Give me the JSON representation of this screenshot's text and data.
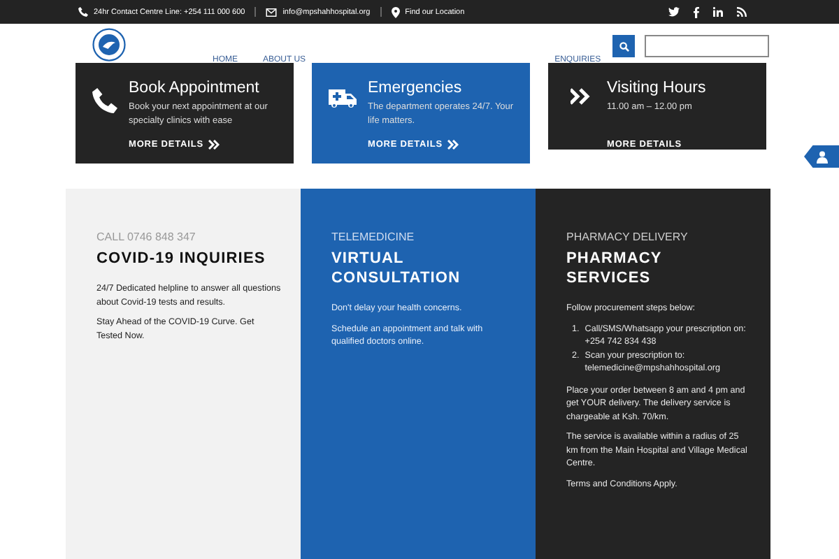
{
  "top_bar": {
    "contacts": [
      {
        "kind": "phone",
        "text": "24hr Contact Centre Line: +254 111 000 600"
      },
      {
        "kind": "mail",
        "text": "info@mpshahhospital.org"
      },
      {
        "kind": "pin",
        "text": "Find our Location"
      }
    ]
  },
  "nav": {
    "items": [
      "HOME",
      "ABOUT US",
      "ENQUIRIES"
    ]
  },
  "cards": [
    {
      "kind": "phone",
      "title": "Book Appointment",
      "text": "Book your next appointment at our specialty clinics with ease",
      "link": "MORE DETAILS",
      "arrow": true
    },
    {
      "kind": "ambulance",
      "title": "Emergencies",
      "text": "The department operates 24/7. Your life matters.",
      "link": "MORE DETAILS",
      "arrow": true
    },
    {
      "kind": "chevrons",
      "title": "Visiting Hours",
      "text": "11.00 am – 12.00 pm",
      "link": "MORE DETAILS",
      "arrow": false
    }
  ],
  "sections": [
    {
      "eyebrow": "CALL 0746 848 347",
      "title": "COVID-19 INQUIRIES",
      "blocks": [
        {
          "kind": "p",
          "text": "24/7 Dedicated helpline to answer all questions about Covid-19 tests and results."
        },
        {
          "kind": "p",
          "text": "Stay Ahead of the COVID-19 Curve.  Get Tested Now."
        }
      ]
    },
    {
      "eyebrow": "TELEMEDICINE",
      "title": "VIRTUAL CONSULTATION",
      "blocks": [
        {
          "kind": "p",
          "text": "Don't delay your health concerns."
        },
        {
          "kind": "p",
          "text": "Schedule an appointment and talk with qualified doctors online."
        }
      ]
    },
    {
      "eyebrow": "PHARMACY DELIVERY",
      "title": "PHARMACY SERVICES",
      "blocks": [
        {
          "kind": "p",
          "text": "Follow procurement steps below:"
        },
        {
          "kind": "ol",
          "items": [
            {
              "number": "1.",
              "text": "Call/SMS/Whatsapp your prescription on:\n+254 742 834 438"
            },
            {
              "number": "2.",
              "text": "Scan your prescription to:\ntelemedicine@mpshahhospital.org"
            }
          ]
        },
        {
          "kind": "p",
          "text": "Place your order between 8 am and 4 pm and get YOUR delivery.  The delivery service is chargeable at Ksh. 70/km."
        },
        {
          "kind": "p",
          "text": "The service is available within a radius of 25 km from the Main Hospital and Village Medical Centre."
        },
        {
          "kind": "p",
          "text": "Terms and Conditions Apply."
        }
      ]
    }
  ]
}
